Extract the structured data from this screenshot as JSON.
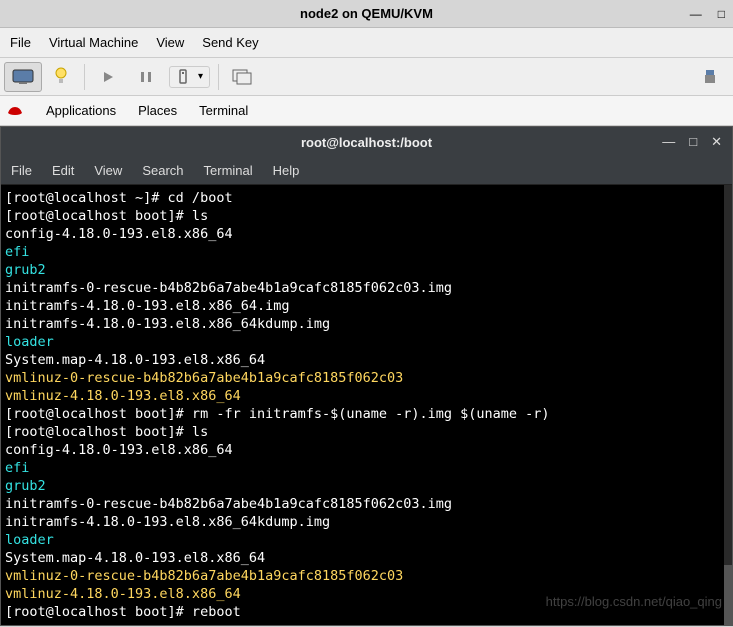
{
  "vm_window": {
    "title": "node2 on QEMU/KVM"
  },
  "outer_menu": {
    "file": "File",
    "virtual_machine": "Virtual Machine",
    "view": "View",
    "send_key": "Send Key"
  },
  "hostbar": {
    "applications": "Applications",
    "places": "Places",
    "terminal": "Terminal"
  },
  "terminal_window": {
    "title": "root@localhost:/boot"
  },
  "term_menu": {
    "file": "File",
    "edit": "Edit",
    "view": "View",
    "search": "Search",
    "terminal": "Terminal",
    "help": "Help"
  },
  "terminal": {
    "lines": [
      {
        "segments": [
          {
            "t": "[root@localhost ~]# cd /boot",
            "c": ""
          }
        ]
      },
      {
        "segments": [
          {
            "t": "[root@localhost boot]# ls",
            "c": ""
          }
        ]
      },
      {
        "segments": [
          {
            "t": "config-4.18.0-193.el8.x86_64",
            "c": ""
          }
        ]
      },
      {
        "segments": [
          {
            "t": "efi",
            "c": "c-cyan"
          }
        ]
      },
      {
        "segments": [
          {
            "t": "grub2",
            "c": "c-cyan"
          }
        ]
      },
      {
        "segments": [
          {
            "t": "initramfs-0-rescue-b4b82b6a7abe4b1a9cafc8185f062c03.img",
            "c": ""
          }
        ]
      },
      {
        "segments": [
          {
            "t": "initramfs-4.18.0-193.el8.x86_64.img",
            "c": ""
          }
        ]
      },
      {
        "segments": [
          {
            "t": "initramfs-4.18.0-193.el8.x86_64kdump.img",
            "c": ""
          }
        ]
      },
      {
        "segments": [
          {
            "t": "loader",
            "c": "c-cyan"
          }
        ]
      },
      {
        "segments": [
          {
            "t": "System.map-4.18.0-193.el8.x86_64",
            "c": ""
          }
        ]
      },
      {
        "segments": [
          {
            "t": "vmlinuz-0-rescue-b4b82b6a7abe4b1a9cafc8185f062c03",
            "c": "c-yellow"
          }
        ]
      },
      {
        "segments": [
          {
            "t": "vmlinuz-4.18.0-193.el8.x86_64",
            "c": "c-yellow"
          }
        ]
      },
      {
        "segments": [
          {
            "t": "[root@localhost boot]# rm -fr initramfs-$(uname -r).img $(uname -r)",
            "c": ""
          }
        ]
      },
      {
        "segments": [
          {
            "t": "[root@localhost boot]# ls",
            "c": ""
          }
        ]
      },
      {
        "segments": [
          {
            "t": "config-4.18.0-193.el8.x86_64",
            "c": ""
          }
        ]
      },
      {
        "segments": [
          {
            "t": "efi",
            "c": "c-cyan"
          }
        ]
      },
      {
        "segments": [
          {
            "t": "grub2",
            "c": "c-cyan"
          }
        ]
      },
      {
        "segments": [
          {
            "t": "initramfs-0-rescue-b4b82b6a7abe4b1a9cafc8185f062c03.img",
            "c": ""
          }
        ]
      },
      {
        "segments": [
          {
            "t": "initramfs-4.18.0-193.el8.x86_64kdump.img",
            "c": ""
          }
        ]
      },
      {
        "segments": [
          {
            "t": "loader",
            "c": "c-cyan"
          }
        ]
      },
      {
        "segments": [
          {
            "t": "System.map-4.18.0-193.el8.x86_64",
            "c": ""
          }
        ]
      },
      {
        "segments": [
          {
            "t": "vmlinuz-0-rescue-b4b82b6a7abe4b1a9cafc8185f062c03",
            "c": "c-yellow"
          }
        ]
      },
      {
        "segments": [
          {
            "t": "vmlinuz-4.18.0-193.el8.x86_64",
            "c": "c-yellow"
          }
        ]
      },
      {
        "segments": [
          {
            "t": "[root@localhost boot]# reboot",
            "c": "",
            "cursor": true
          }
        ]
      }
    ]
  },
  "watermark": "https://blog.csdn.net/qiao_qing"
}
